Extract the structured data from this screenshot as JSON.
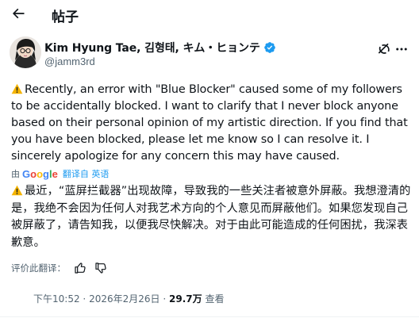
{
  "header": {
    "back_icon": "arrow-left-icon",
    "title": "帖子"
  },
  "author": {
    "display_name": "Kim Hyung Tae, 김형태, キム・ヒョンテ",
    "verified_icon": "verified-badge-icon",
    "verified_color": "#1d9bf0",
    "handle": "@jamm3rd",
    "grok_icon": "grok-icon",
    "more_icon": "more-horizontal-icon"
  },
  "tweet": {
    "warning_icon": "warning-sign-icon",
    "text_en": "Recently, an error with \"Blue Blocker\" caused some of my followers to be accidentally blocked. I want to clarify that I never block anyone based on their personal opinion of my artistic direction. If you find that you have been blocked, please let me know so I can resolve it. I sincerely apologize for any concern this may have caused.",
    "translated_prefix": "由",
    "translated_provider": "Google",
    "translated_link": "翻译自 英语",
    "text_zh": "最近，“蓝屏拦截器”出现故障，导致我的一些关注者被意外屏蔽。我想澄清的是，我绝不会因为任何人对我艺术方向的个人意见而屏蔽他们。如果您发现自己被屏蔽了，请告知我，以便我尽快解决。对于由此可能造成的任何困扰，我深表歉意。",
    "rate_label": "评价此翻译：",
    "thumbs_up_icon": "thumbs-up-icon",
    "thumbs_down_icon": "thumbs-down-icon"
  },
  "meta": {
    "time": "下午10:52",
    "separator": "·",
    "date": "2026年2月26日",
    "views_count": "29.7万",
    "views_label": "查看"
  },
  "colors": {
    "text_primary": "#0f1419",
    "text_secondary": "#536471",
    "link": "#1d9bf0",
    "warning": "#f5b400"
  }
}
